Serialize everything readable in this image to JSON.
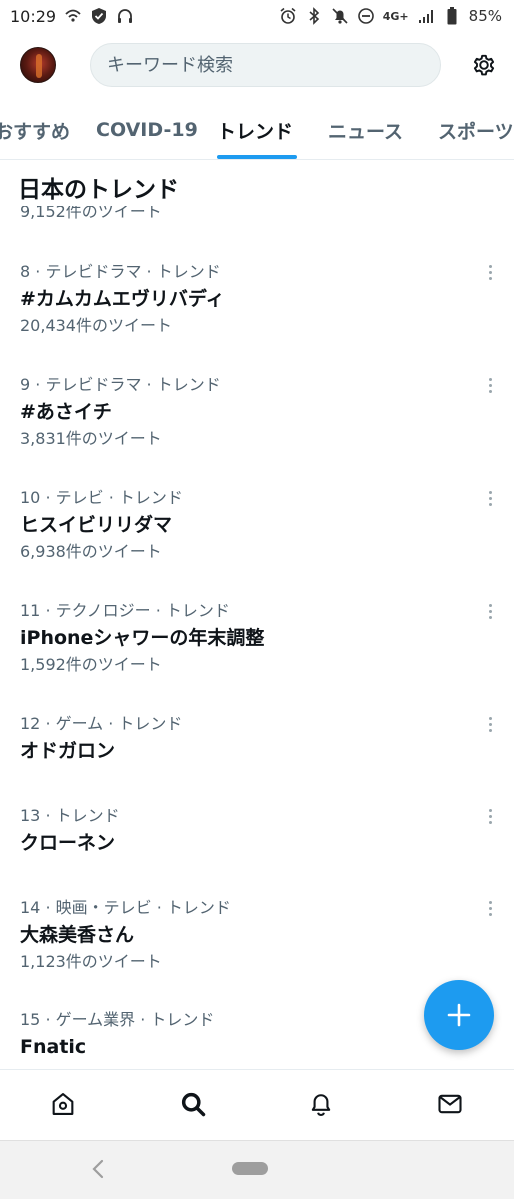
{
  "status_bar": {
    "time": "10:29",
    "network": "4G+",
    "battery": "85%",
    "left_icons": [
      "wifi-call-icon",
      "shield-icon",
      "headphones-icon"
    ],
    "right_icons": [
      "alarm-icon",
      "bluetooth-icon",
      "mute-icon",
      "dnd-icon",
      "signal-icon",
      "battery-icon"
    ]
  },
  "header": {
    "search_placeholder": "キーワード検索",
    "settings_icon": "gear-icon"
  },
  "tabs": [
    "おすすめ",
    "COVID-19",
    "トレンド",
    "ニュース",
    "スポーツ"
  ],
  "active_tab": "トレンド",
  "section_title": "日本のトレンド",
  "partial_item_count": "9,152件のツイート",
  "trends": [
    {
      "meta": "8 · テレビドラマ · トレンド",
      "name": "#カムカムエヴリバディ",
      "count": "20,434件のツイート"
    },
    {
      "meta": "9 · テレビドラマ · トレンド",
      "name": "#あさイチ",
      "count": "3,831件のツイート"
    },
    {
      "meta": "10 · テレビ · トレンド",
      "name": "ヒスイビリリダマ",
      "count": "6,938件のツイート"
    },
    {
      "meta": "11 · テクノロジー · トレンド",
      "name": "iPhoneシャワーの年末調整",
      "count": "1,592件のツイート"
    },
    {
      "meta": "12 · ゲーム · トレンド",
      "name": "オドガロン",
      "count": ""
    },
    {
      "meta": "13 · トレンド",
      "name": "クローネン",
      "count": ""
    },
    {
      "meta": "14 · 映画・テレビ · トレンド",
      "name": "大森美香さん",
      "count": "1,123件のツイート"
    },
    {
      "meta": "15 · ゲーム業界 · トレンド",
      "name": "Fnatic",
      "count": ""
    }
  ],
  "fab_icon": "plus-icon",
  "bottom_nav": [
    "home-icon",
    "search-icon",
    "notifications-icon",
    "messages-icon"
  ],
  "colors": {
    "accent": "#1d9bf0",
    "text": "#0f1419",
    "secondary": "#536471"
  }
}
